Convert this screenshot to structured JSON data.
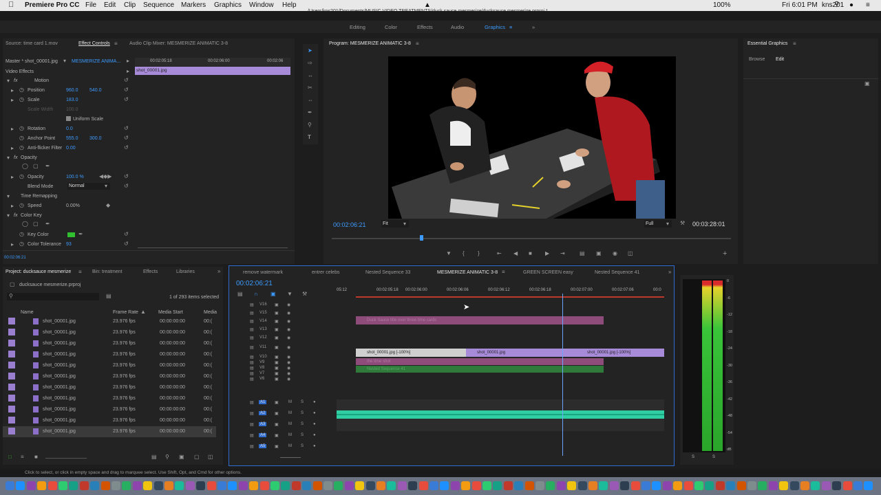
{
  "menubar": {
    "app": "Premiere Pro CC",
    "items": [
      "File",
      "Edit",
      "Clip",
      "Sequence",
      "Markers",
      "Graphics",
      "Window",
      "Help"
    ],
    "path": "/Users/kns201/Documents/MUSIC VIDEO TREATMENTS/duck sauce mesmerize/ducksauce mesmerize.prproj *",
    "battery": "100%",
    "clock": "Fri 6:01 PM",
    "user": "kns201"
  },
  "workspaces": [
    "Editing",
    "Color",
    "Effects",
    "Audio",
    "Graphics"
  ],
  "workspace_active": "Graphics",
  "source_panel": {
    "tabs": [
      "Source: time card 1.mov",
      "Effect Controls",
      "Audio Clip Mixer: MESMERIZE ANIMATIC 3-8"
    ],
    "master": "Master * shot_00001.jpg",
    "sequence": "MESMERIZE ANIMA...",
    "ruler": [
      "00:02:05:18",
      "00:02:06:00",
      "00:02:06"
    ],
    "clip": "shot_00001.jpg",
    "video_effects": "Video Effects",
    "motion": "Motion",
    "position_label": "Position",
    "position_x": "960.0",
    "position_y": "540.0",
    "scale_label": "Scale",
    "scale": "183.0",
    "scale_width_label": "Scale Width",
    "scale_width": "100.0",
    "uniform_scale": "Uniform Scale",
    "rotation_label": "Rotation",
    "rotation": "0.0",
    "anchor_label": "Anchor Point",
    "anchor_x": "555.0",
    "anchor_y": "300.0",
    "antiflicker_label": "Anti-flicker Filter",
    "antiflicker": "0.00",
    "opacity_group": "Opacity",
    "opacity_label": "Opacity",
    "opacity": "100.0 %",
    "blend_label": "Blend Mode",
    "blend": "Normal",
    "time_remap": "Time Remapping",
    "speed_label": "Speed",
    "speed": "0.00%",
    "color_key": "Color Key",
    "key_color_label": "Key Color",
    "key_color": "#2fbf2f",
    "tolerance_label": "Color Tolerance",
    "tolerance": "93",
    "timecode": "00:02:06:21"
  },
  "program": {
    "title": "Program: MESMERIZE ANIMATIC 3-8",
    "timecode": "00:02:06:21",
    "fit": "Fit",
    "quality": "Full",
    "duration": "00:03:28:01"
  },
  "essential_graphics": {
    "title": "Essential Graphics",
    "tabs": [
      "Browse",
      "Edit"
    ]
  },
  "project": {
    "tabs": [
      "Project: ducksauce mesmerize",
      "Bin: treatment",
      "Effects",
      "Libraries"
    ],
    "file": "ducksauce mesmerize.prproj",
    "count": "1 of 293 items selected",
    "columns": [
      "Name",
      "Frame Rate",
      "Media Start",
      "Media"
    ],
    "rows": [
      {
        "name": "shot_00001.jpg",
        "fps": "23.976 fps",
        "start": "00:00:00:00",
        "media": "00:("
      },
      {
        "name": "shot_00001.jpg",
        "fps": "23.976 fps",
        "start": "00:00:00:00",
        "media": "00:("
      },
      {
        "name": "shot_00001.jpg",
        "fps": "23.976 fps",
        "start": "00:00:00:00",
        "media": "00:("
      },
      {
        "name": "shot_00001.jpg",
        "fps": "23.976 fps",
        "start": "00:00:00:00",
        "media": "00:("
      },
      {
        "name": "shot_00001.jpg",
        "fps": "23.976 fps",
        "start": "00:00:00:00",
        "media": "00:("
      },
      {
        "name": "shot_00001.jpg",
        "fps": "23.976 fps",
        "start": "00:00:00:00",
        "media": "00:("
      },
      {
        "name": "shot_00001.jpg",
        "fps": "23.976 fps",
        "start": "00:00:00:00",
        "media": "00:("
      },
      {
        "name": "shot_00001.jpg",
        "fps": "23.976 fps",
        "start": "00:00:00:00",
        "media": "00:("
      },
      {
        "name": "shot_00001.jpg",
        "fps": "23.976 fps",
        "start": "00:00:00:00",
        "media": "00:("
      },
      {
        "name": "shot_00001.jpg",
        "fps": "23.976 fps",
        "start": "00:00:00:00",
        "media": "00:("
      },
      {
        "name": "shot_00001.jpg",
        "fps": "23.976 fps",
        "start": "00:00:00:00",
        "media": "00:("
      }
    ]
  },
  "timeline": {
    "tabs": [
      "remove watermark",
      "entrer celebs",
      "Nested Sequence 33",
      "MESMERIZE ANIMATIC 3-8",
      "GREEN SCREEN easy",
      "Nested Sequence 41"
    ],
    "active_tab": "MESMERIZE ANIMATIC 3-8",
    "timecode": "00:02:06:21",
    "ruler": [
      "05:12",
      "00:02:05:18",
      "00:02:06:00",
      "00:02:06:06",
      "00:02:06:12",
      "00:02:06:18",
      "00:02:07:00",
      "00:02:07:06",
      "00:0"
    ],
    "video_tracks": [
      "V16",
      "V15",
      "V14",
      "V13",
      "V12",
      "V11",
      "V10",
      "V9",
      "V8",
      "V7",
      "V6"
    ],
    "audio_tracks": [
      "A1",
      "A2",
      "A3",
      "A4",
      "A5"
    ],
    "clips": {
      "title_clip": "Duck Sauce title over three time cards",
      "shot_a": "shot_00001.jpg [-100%]",
      "shot_b": "shot_00001.jpg",
      "shot_c": "shot_00001.jpg [-100%]",
      "time_card": "the time shot",
      "nested": "Nested Sequence 41"
    }
  },
  "meter": {
    "scale": [
      "0",
      "-6",
      "-12",
      "-18",
      "-24",
      "-30",
      "-36",
      "-42",
      "-48",
      "-54",
      "dB"
    ],
    "channels": [
      "S",
      "S"
    ]
  },
  "status": "Click to select, or click in empty space and drag to marquee select. Use Shift, Opt, and Cmd for other options."
}
